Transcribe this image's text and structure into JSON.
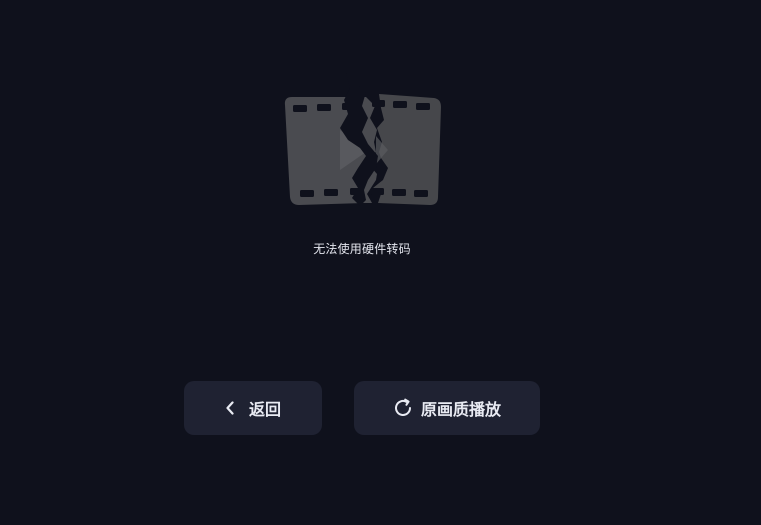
{
  "error": {
    "illustration_icon": "broken-film-icon",
    "message": "无法使用硬件转码"
  },
  "actions": {
    "back": {
      "icon": "chevron-left-icon",
      "label": "返回"
    },
    "play_original": {
      "icon": "refresh-icon",
      "label": "原画质播放"
    }
  },
  "colors": {
    "background": "#0f111c",
    "button_background": "#1f2232",
    "text": "#e9ebf3",
    "illustration": "#4a4b50"
  }
}
